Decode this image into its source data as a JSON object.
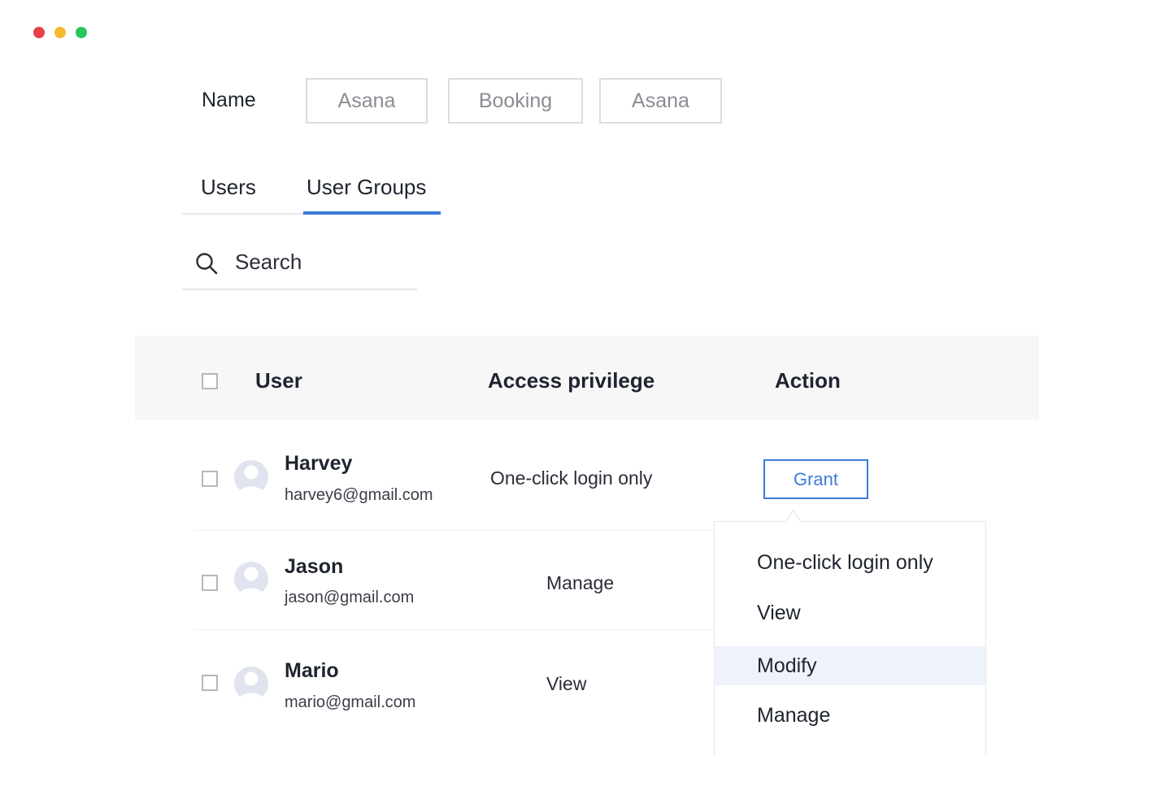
{
  "name_row": {
    "label": "Name",
    "chips": [
      "Asana",
      "Booking",
      "Asana"
    ]
  },
  "tabs": [
    {
      "label": "Users",
      "active": false
    },
    {
      "label": "User Groups",
      "active": true
    }
  ],
  "search": {
    "placeholder": "Search",
    "icon": "search-icon"
  },
  "table": {
    "headers": [
      "User",
      "Access privilege",
      "Action"
    ],
    "rows": [
      {
        "name": "Harvey",
        "email": "harvey6@gmail.com",
        "privilege": "One-click login only",
        "action": "Grant"
      },
      {
        "name": "Jason",
        "email": "jason@gmail.com",
        "privilege": "Manage"
      },
      {
        "name": "Mario",
        "email": "mario@gmail.com",
        "privilege": "View"
      }
    ]
  },
  "dropdown": {
    "items": [
      "One-click login only",
      "View",
      "Modify",
      "Manage"
    ],
    "highlighted": "Modify"
  },
  "colors": {
    "accent": "#3e7bdc",
    "window_red": "#e8404a",
    "window_yellow": "#f5b92e",
    "window_green": "#27c55e"
  }
}
